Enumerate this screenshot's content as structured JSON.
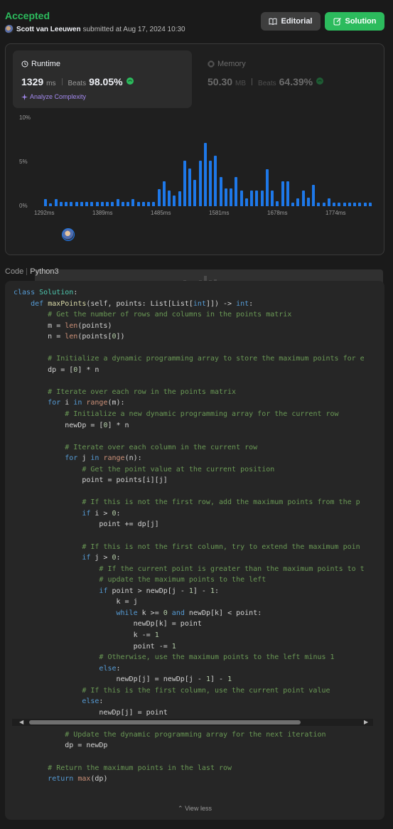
{
  "submission": {
    "status": "Accepted",
    "author": "Scott van Leeuwen",
    "submitted_text": "submitted at Aug 17, 2024 10:30",
    "editorial_label": "Editorial",
    "solution_label": "Solution",
    "colors": {
      "accepted": "#2cbb5d",
      "bar": "#1e78e8",
      "analyze": "#a48af0"
    }
  },
  "runtime": {
    "title": "Runtime",
    "value": "1329",
    "unit": "ms",
    "beats_label": "Beats",
    "beats_value": "98.05%",
    "analyze_label": "Analyze Complexity"
  },
  "memory": {
    "title": "Memory",
    "value": "50.30",
    "unit": "MB",
    "beats_label": "Beats",
    "beats_value": "64.39%"
  },
  "chart_data": {
    "type": "bar",
    "ylabels": [
      "10%",
      "5%",
      "0%"
    ],
    "ylim": [
      0,
      10
    ],
    "xlabels": [
      "1292ms",
      "1389ms",
      "1485ms",
      "1581ms",
      "1678ms",
      "1774ms"
    ],
    "values": [
      0.8,
      0.3,
      0.8,
      0.5,
      0.5,
      0.5,
      0.5,
      0.5,
      0.5,
      0.5,
      0.5,
      0.5,
      0.5,
      0.5,
      0.8,
      0.5,
      0.5,
      0.8,
      0.5,
      0.5,
      0.5,
      0.5,
      1.9,
      2.8,
      1.8,
      1.2,
      1.7,
      5.2,
      4.3,
      3.0,
      5.2,
      7.2,
      5.2,
      5.7,
      3.3,
      2.0,
      2.0,
      3.3,
      1.8,
      0.9,
      1.8,
      1.8,
      1.8,
      4.2,
      1.8,
      0.6,
      2.8,
      2.8,
      0.4,
      0.9,
      1.8,
      1.0,
      2.4,
      0.4,
      0.4,
      0.9,
      0.4,
      0.4,
      0.4,
      0.4,
      0.4,
      0.4,
      0.4,
      0.4
    ],
    "highlight_index": 7
  },
  "code": {
    "label": "Code",
    "language": "Python3",
    "view_less_label": "View less",
    "lines": [
      "class Solution:",
      "    def maxPoints(self, points: List[List[int]]) -> int:",
      "        # Get the number of rows and columns in the points matrix",
      "        m = len(points)",
      "        n = len(points[0])",
      "",
      "        # Initialize a dynamic programming array to store the maximum points for e",
      "        dp = [0] * n",
      "",
      "        # Iterate over each row in the points matrix",
      "        for i in range(m):",
      "            # Initialize a new dynamic programming array for the current row",
      "            newDp = [0] * n",
      "",
      "            # Iterate over each column in the current row",
      "            for j in range(n):",
      "                # Get the point value at the current position",
      "                point = points[i][j]",
      "",
      "                # If this is not the first row, add the maximum points from the p",
      "                if i > 0:",
      "                    point += dp[j]",
      "",
      "                # If this is not the first column, try to extend the maximum poin",
      "                if j > 0:",
      "                    # If the current point is greater than the maximum points to t",
      "                    # update the maximum points to the left",
      "                    if point > newDp[j - 1] - 1:",
      "                        k = j",
      "                        while k >= 0 and newDp[k] < point:",
      "                            newDp[k] = point",
      "                            k -= 1",
      "                            point -= 1",
      "                    # Otherwise, use the maximum points to the left minus 1",
      "                    else:",
      "                        newDp[j] = newDp[j - 1] - 1",
      "                # If this is the first column, use the current point value",
      "                else:",
      "                    newDp[j] = point",
      "",
      "            # Update the dynamic programming array for the next iteration",
      "            dp = newDp",
      "",
      "        # Return the maximum points in the last row",
      "        return max(dp)"
    ]
  }
}
